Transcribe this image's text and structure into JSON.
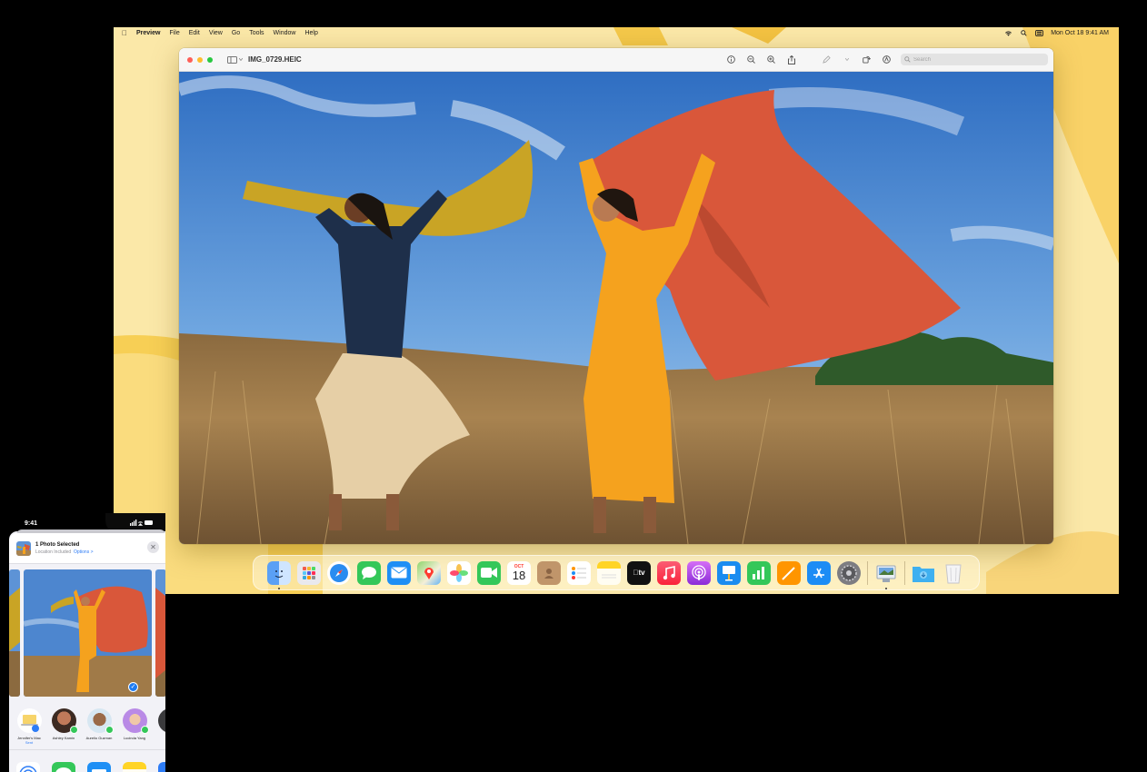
{
  "mac": {
    "menubar": {
      "app_name": "Preview",
      "menus": [
        "File",
        "Edit",
        "View",
        "Go",
        "Tools",
        "Window",
        "Help"
      ],
      "clock": "Mon Oct 18  9:41 AM"
    },
    "window": {
      "title": "IMG_0729.HEIC",
      "search_placeholder": "Search"
    },
    "dock": {
      "apps": [
        "Finder",
        "Launchpad",
        "Safari",
        "Messages",
        "Mail",
        "Maps",
        "Photos",
        "FaceTime",
        "Calendar",
        "Contacts",
        "Reminders",
        "Notes",
        "TV",
        "Music",
        "Podcasts",
        "Keynote",
        "Numbers",
        "Pages",
        "App Store",
        "System Preferences"
      ],
      "calendar_month": "OCT",
      "calendar_day": "18",
      "tv_label": "tv"
    }
  },
  "phone": {
    "time": "9:41",
    "sheet": {
      "title": "1 Photo Selected",
      "subtitle": "Location Included",
      "options_link": "Options >",
      "close": "✕"
    },
    "people": [
      {
        "name": "Jennifer's Mac",
        "sub": "Sent"
      },
      {
        "name": "Ashley Kamin"
      },
      {
        "name": "Aurelio Guzman"
      },
      {
        "name": "Lucinda Yang"
      }
    ]
  },
  "colors": {
    "wallpaper": "#fbe6a4",
    "accent_blue": "#1e7cf2",
    "close_red": "#fe5f57",
    "minimize_yellow": "#febc2e",
    "zoom_green": "#28c840"
  }
}
